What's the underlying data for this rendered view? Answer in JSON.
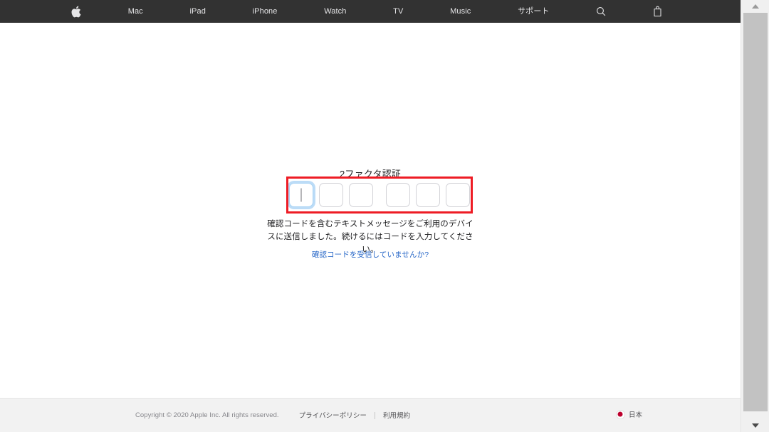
{
  "globalnav": {
    "items": [
      {
        "name": "apple-logo",
        "label": "",
        "icon": "apple-logo-icon"
      },
      {
        "name": "mac",
        "label": "Mac",
        "icon": ""
      },
      {
        "name": "ipad",
        "label": "iPad",
        "icon": ""
      },
      {
        "name": "iphone",
        "label": "iPhone",
        "icon": ""
      },
      {
        "name": "watch",
        "label": "Watch",
        "icon": ""
      },
      {
        "name": "tv",
        "label": "TV",
        "icon": ""
      },
      {
        "name": "music",
        "label": "Music",
        "icon": ""
      },
      {
        "name": "support",
        "label": "サポート",
        "icon": ""
      },
      {
        "name": "search",
        "label": "",
        "icon": "search-icon"
      },
      {
        "name": "bag",
        "label": "",
        "icon": "shopping-bag-icon"
      }
    ],
    "background_color": "#323232",
    "text_color": "#f5f5f7"
  },
  "auth": {
    "title": "2ファクタ認証",
    "description": "確認コードを含むテキストメッセージをご利用のデバイスに送信しました。続けるにはコードを入力してください。",
    "resend_link": "確認コードを受信していませんか?",
    "link_color": "#2968c8",
    "code_digits": [
      "",
      "",
      "",
      "",
      "",
      ""
    ],
    "focused_index": 0,
    "box_border_color": "#d2d2d7",
    "focus_ring_color": "#bcdcf7"
  },
  "annotation": {
    "label": "code-input-highlight",
    "color": "#ee1c25"
  },
  "footer": {
    "copyright": "Copyright © 2020 Apple Inc. All rights reserved.",
    "links": [
      {
        "name": "privacy-policy",
        "label": "プライバシーポリシー"
      },
      {
        "name": "terms-of-use",
        "label": "利用規約"
      }
    ],
    "locale": "日本",
    "background_color": "#f2f2f2"
  },
  "scrollbar": {
    "position": "right",
    "thumb_color": "#c2c2c2"
  }
}
